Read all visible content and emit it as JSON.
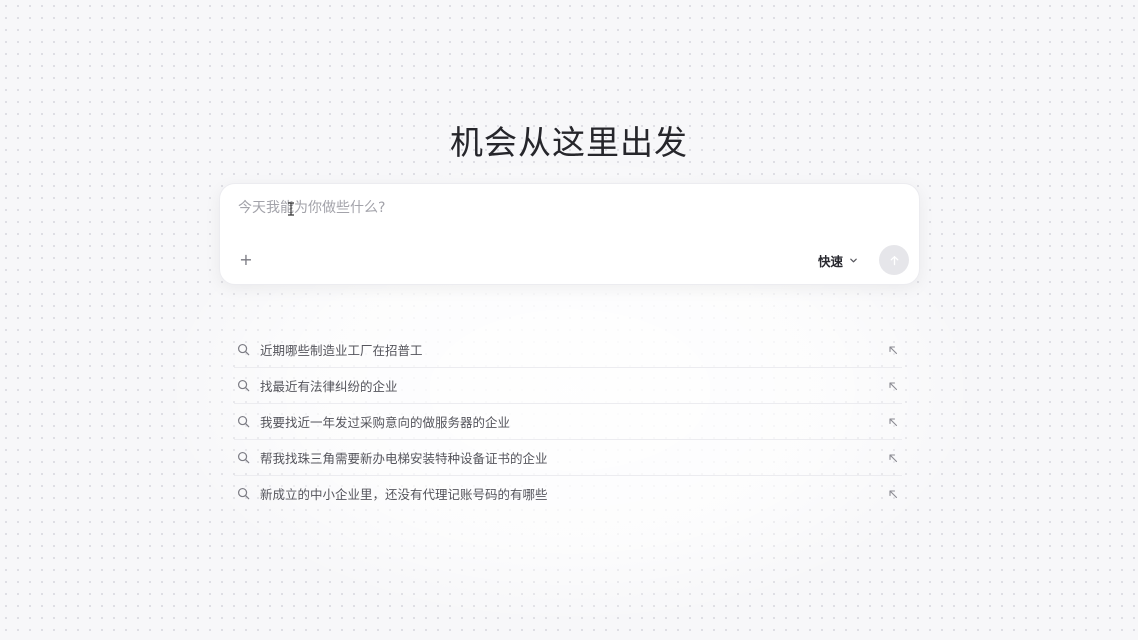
{
  "hero": {
    "title": "机会从这里出发"
  },
  "composer": {
    "placeholder": "今天我能为你做些什么?",
    "value": "",
    "plus_label": "+",
    "mode_label": "快速"
  },
  "icons": {
    "add": "plus-icon",
    "mode": "chevron-down-icon",
    "send": "arrow-up-icon",
    "suggestion_lead": "search-icon",
    "suggestion_trail": "arrow-up-left-icon"
  },
  "suggestions": [
    {
      "text": "近期哪些制造业工厂在招普工"
    },
    {
      "text": "找最近有法律纠纷的企业"
    },
    {
      "text": "我要找近一年发过采购意向的做服务器的企业"
    },
    {
      "text": "帮我找珠三角需要新办电梯安装特种设备证书的企业"
    },
    {
      "text": "新成立的中小企业里，还没有代理记账号码的有哪些"
    }
  ],
  "colors": {
    "background": "#f7f7f9",
    "card": "#ffffff",
    "send_button": "#e6e6ea",
    "text_primary": "#26262b",
    "text_muted": "#55555c"
  }
}
